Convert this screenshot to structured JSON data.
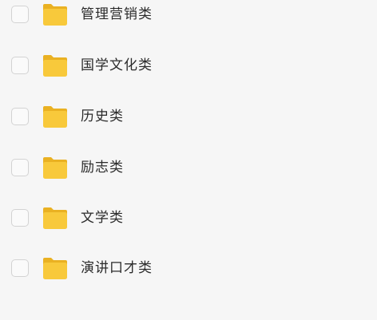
{
  "folders": [
    {
      "name": "管理营销类",
      "checked": false,
      "icon": "folder-icon"
    },
    {
      "name": "国学文化类",
      "checked": false,
      "icon": "folder-icon"
    },
    {
      "name": "历史类",
      "checked": false,
      "icon": "folder-icon"
    },
    {
      "name": "励志类",
      "checked": false,
      "icon": "folder-icon"
    },
    {
      "name": "文学类",
      "checked": false,
      "icon": "folder-icon"
    },
    {
      "name": "演讲口才类",
      "checked": false,
      "icon": "folder-icon"
    }
  ],
  "colors": {
    "background": "#f6f6f6",
    "folder_body": "#f8c93b",
    "folder_tab": "#eab122",
    "checkbox_border": "#d3d3d3",
    "text": "#2b2b2b"
  }
}
